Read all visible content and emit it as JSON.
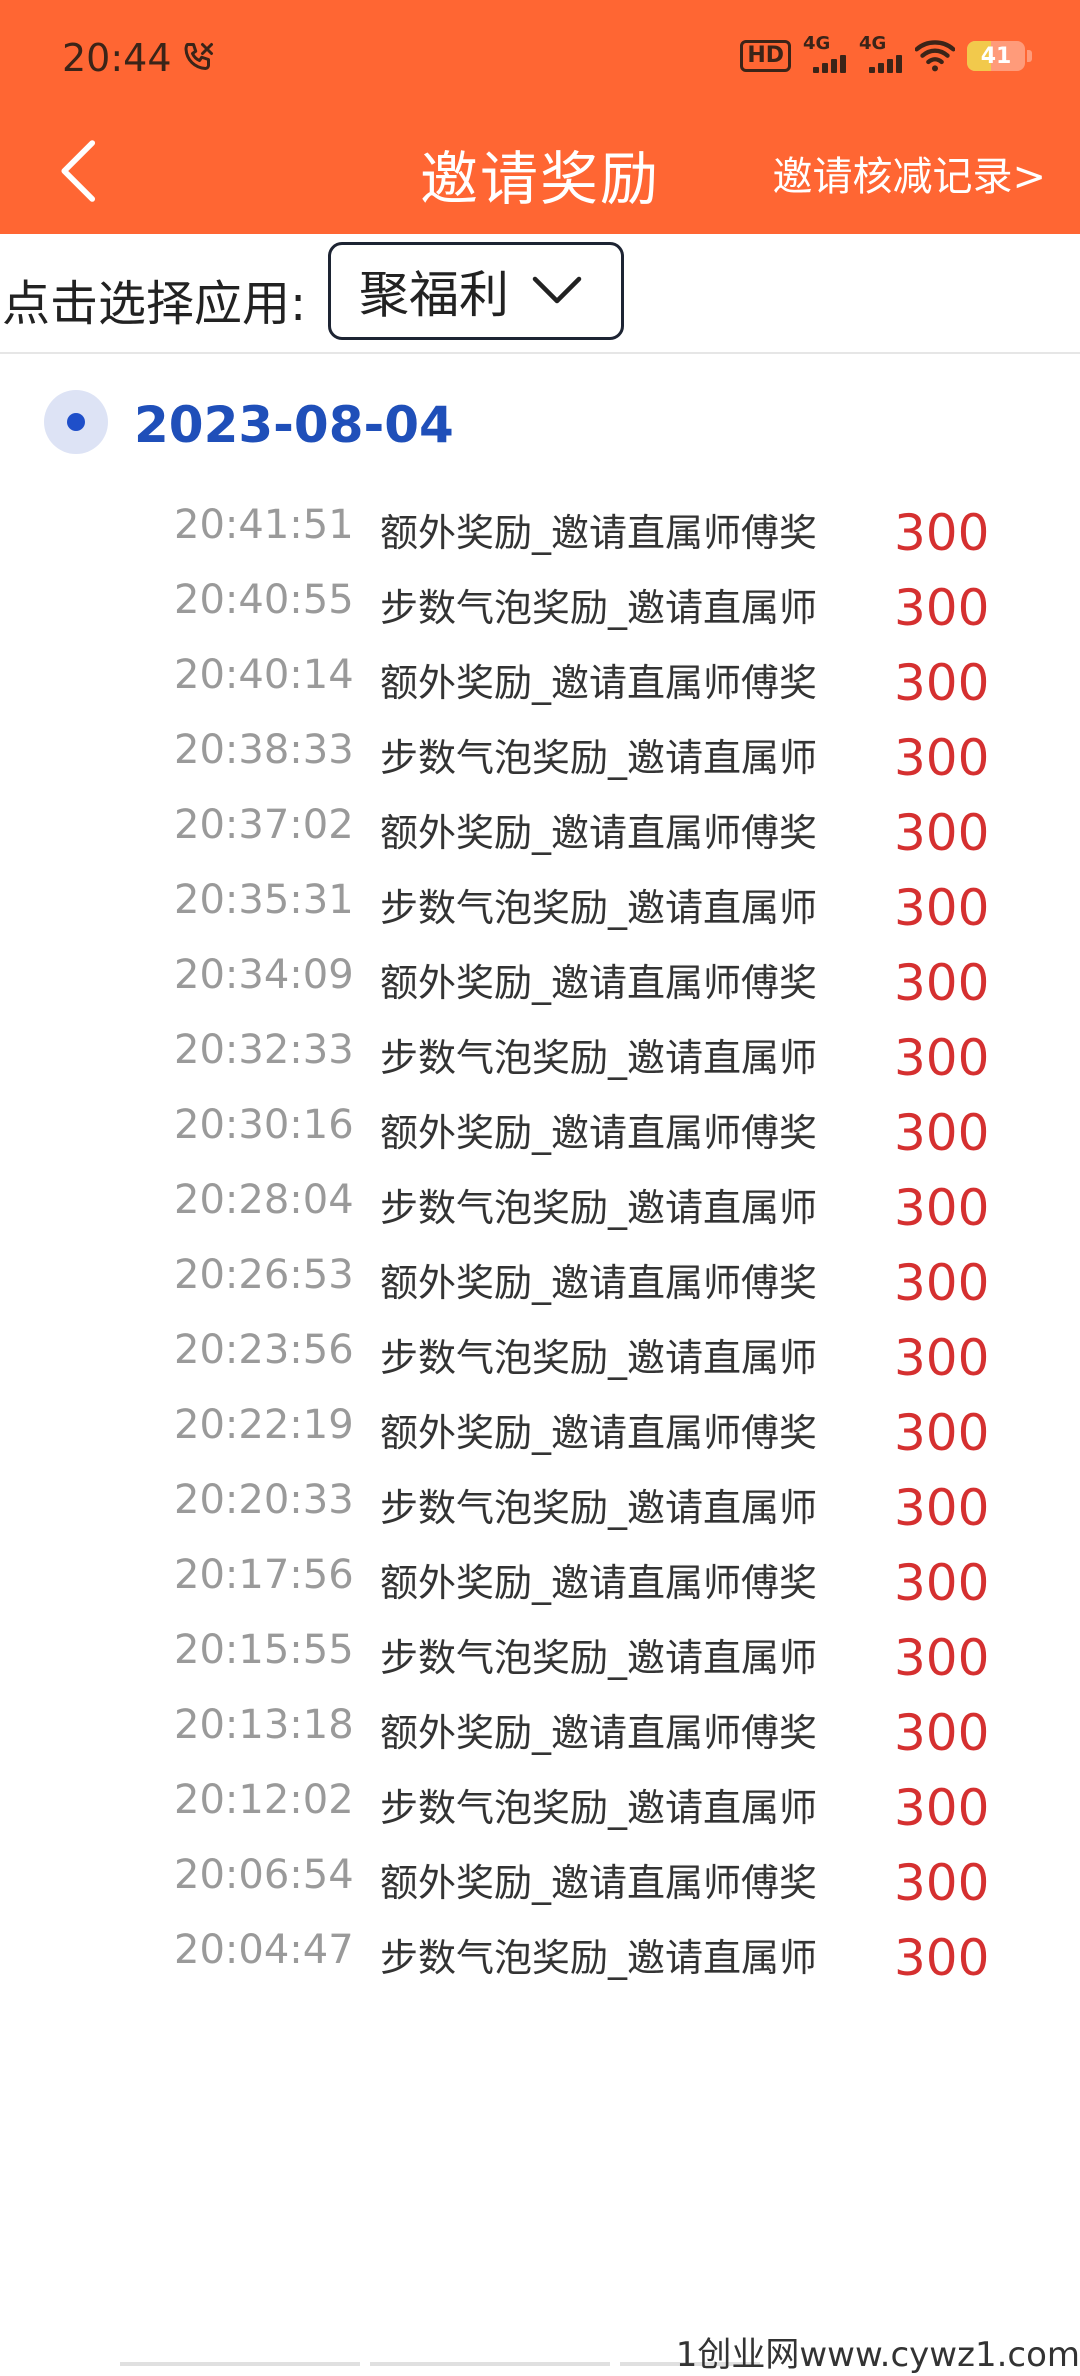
{
  "status_bar": {
    "time": "20:44",
    "hd_label": "HD",
    "signal1_label": "4G",
    "signal2_label": "4G",
    "battery_level": "41",
    "battery_fraction": 0.41
  },
  "nav": {
    "title": "邀请奖励",
    "right_link": "邀请核减记录>"
  },
  "selector": {
    "label": "点击选择应用:",
    "value": "聚福利"
  },
  "date_group": {
    "date": "2023-08-04"
  },
  "records": [
    {
      "time": "20:41:51",
      "desc": "额外奖励_邀请直属师傅奖",
      "amount": "300"
    },
    {
      "time": "20:40:55",
      "desc": "步数气泡奖励_邀请直属师",
      "amount": "300"
    },
    {
      "time": "20:40:14",
      "desc": "额外奖励_邀请直属师傅奖",
      "amount": "300"
    },
    {
      "time": "20:38:33",
      "desc": "步数气泡奖励_邀请直属师",
      "amount": "300"
    },
    {
      "time": "20:37:02",
      "desc": "额外奖励_邀请直属师傅奖",
      "amount": "300"
    },
    {
      "time": "20:35:31",
      "desc": "步数气泡奖励_邀请直属师",
      "amount": "300"
    },
    {
      "time": "20:34:09",
      "desc": "额外奖励_邀请直属师傅奖",
      "amount": "300"
    },
    {
      "time": "20:32:33",
      "desc": "步数气泡奖励_邀请直属师",
      "amount": "300"
    },
    {
      "time": "20:30:16",
      "desc": "额外奖励_邀请直属师傅奖",
      "amount": "300"
    },
    {
      "time": "20:28:04",
      "desc": "步数气泡奖励_邀请直属师",
      "amount": "300"
    },
    {
      "time": "20:26:53",
      "desc": "额外奖励_邀请直属师傅奖",
      "amount": "300"
    },
    {
      "time": "20:23:56",
      "desc": "步数气泡奖励_邀请直属师",
      "amount": "300"
    },
    {
      "time": "20:22:19",
      "desc": "额外奖励_邀请直属师傅奖",
      "amount": "300"
    },
    {
      "time": "20:20:33",
      "desc": "步数气泡奖励_邀请直属师",
      "amount": "300"
    },
    {
      "time": "20:17:56",
      "desc": "额外奖励_邀请直属师傅奖",
      "amount": "300"
    },
    {
      "time": "20:15:55",
      "desc": "步数气泡奖励_邀请直属师",
      "amount": "300"
    },
    {
      "time": "20:13:18",
      "desc": "额外奖励_邀请直属师傅奖",
      "amount": "300"
    },
    {
      "time": "20:12:02",
      "desc": "步数气泡奖励_邀请直属师",
      "amount": "300"
    },
    {
      "time": "20:06:54",
      "desc": "额外奖励_邀请直属师傅奖",
      "amount": "300"
    },
    {
      "time": "20:04:47",
      "desc": "步数气泡奖励_邀请直属师",
      "amount": "300"
    }
  ],
  "watermark": "1创业网www.cywz1.com",
  "colors": {
    "header_bg": "#FF6633",
    "date_blue": "#1F4FB9",
    "amount_red": "#D53030",
    "time_gray": "#9A9A9A"
  },
  "icons": {
    "back": "chevron-left-icon",
    "dropdown": "chevron-down-icon",
    "call": "call-icon",
    "wifi": "wifi-icon",
    "battery": "battery-icon"
  }
}
